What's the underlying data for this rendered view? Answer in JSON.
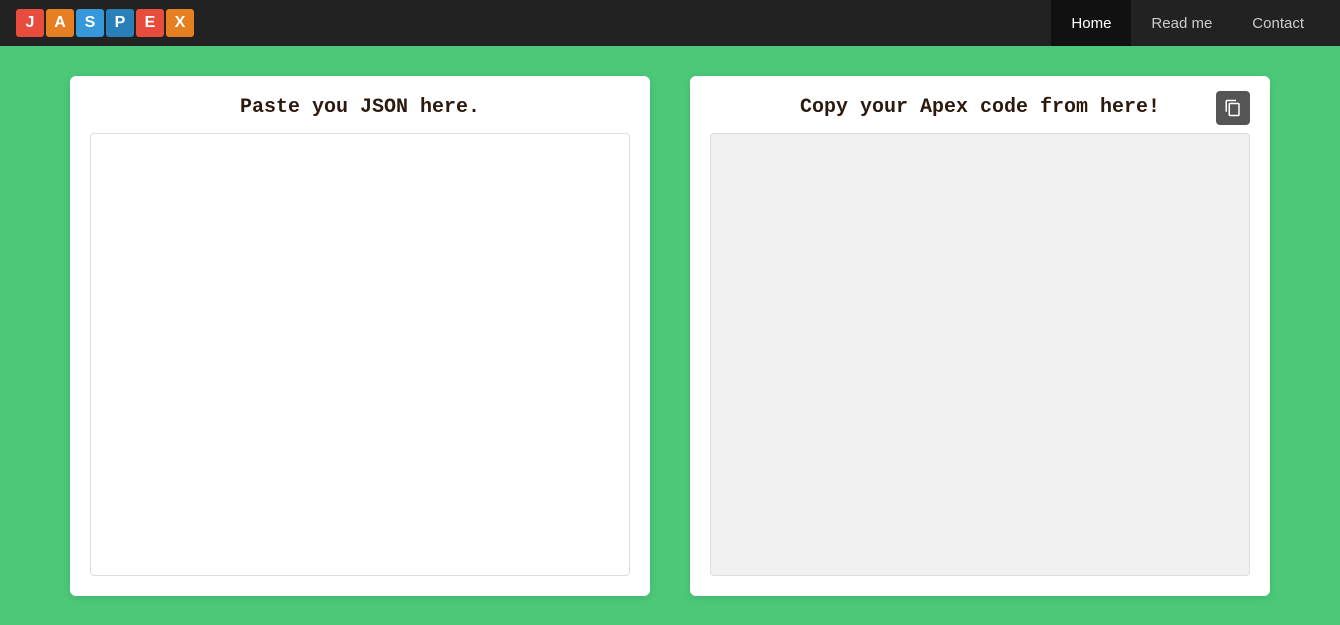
{
  "navbar": {
    "logo": {
      "letters": [
        {
          "char": "J",
          "class": "j"
        },
        {
          "char": "A",
          "class": "a"
        },
        {
          "char": "S",
          "class": "s"
        },
        {
          "char": "P",
          "class": "p"
        },
        {
          "char": "E",
          "class": "e"
        },
        {
          "char": "X",
          "class": "x"
        }
      ]
    },
    "links": [
      {
        "label": "Home",
        "active": true
      },
      {
        "label": "Read me",
        "active": false
      },
      {
        "label": "Contact",
        "active": false
      }
    ]
  },
  "main": {
    "left_panel": {
      "title": "Paste you JSON here.",
      "placeholder": ""
    },
    "right_panel": {
      "title": "Copy your Apex code from here!",
      "copy_button_label": "⧉",
      "placeholder": ""
    }
  },
  "colors": {
    "background": "#4cc878",
    "navbar_bg": "#222",
    "active_nav_bg": "#111"
  }
}
